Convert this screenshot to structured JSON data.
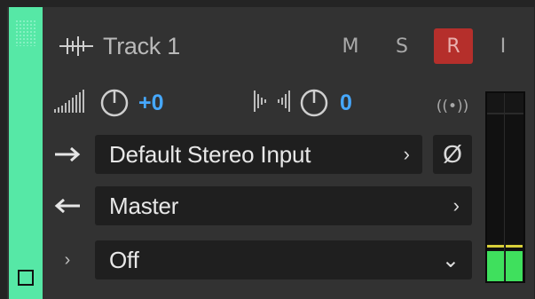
{
  "track": {
    "name": "Track 1",
    "color": "#56e8a6",
    "buttons": {
      "mute": "M",
      "solo": "S",
      "record": "R",
      "input_monitor": "I"
    }
  },
  "volume": {
    "value": "+0"
  },
  "pan": {
    "value": "0"
  },
  "input": {
    "label": "Default Stereo Input",
    "chevron": "›",
    "phase_symbol": "Ø"
  },
  "output": {
    "label": "Master",
    "chevron": "›"
  },
  "automation": {
    "expander": "›",
    "mode": "Off",
    "chevron": "⌄"
  },
  "meter": {
    "left_level": 0.16,
    "right_level": 0.16,
    "peak_level": 0.18
  },
  "icons": {
    "track_type": "waveform-icon",
    "volume": "volume-bars-icon",
    "pan": "stereo-pan-icon",
    "broadcast": "broadcast-icon",
    "input_arrow": "arrow-right-icon",
    "output_arrow": "arrow-left-icon"
  },
  "broadcast_symbol": "((•))"
}
